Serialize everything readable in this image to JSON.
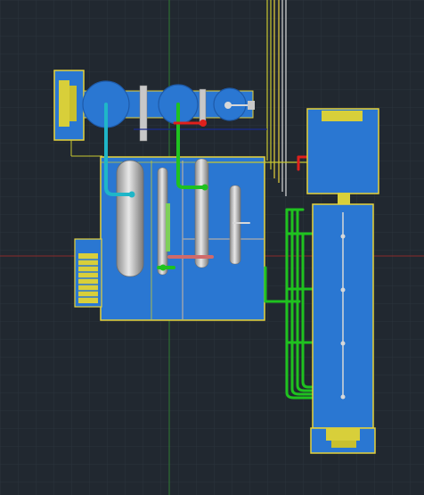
{
  "app": {
    "view": "cad-modelspace",
    "mode": "3D plant layout"
  },
  "theme": {
    "background": "#212830",
    "grid": "#2b333d",
    "equipment_fill": "#2a77d2",
    "equipment_edge": "#e6d23a",
    "pipe_green": "#1fc21f",
    "pipe_cyan": "#1fb6c8",
    "pipe_red": "#e0201c",
    "pipe_yellow": "#c8c830",
    "pipe_white": "#d8d8d8",
    "vessel": "#c8c8c8",
    "axis_y": "#2e7d32",
    "axis_x": "#8b2a2a"
  },
  "icons": [
    "ucs-crosshair-icon",
    "vessel-icon",
    "pump-icon",
    "valve-icon"
  ]
}
